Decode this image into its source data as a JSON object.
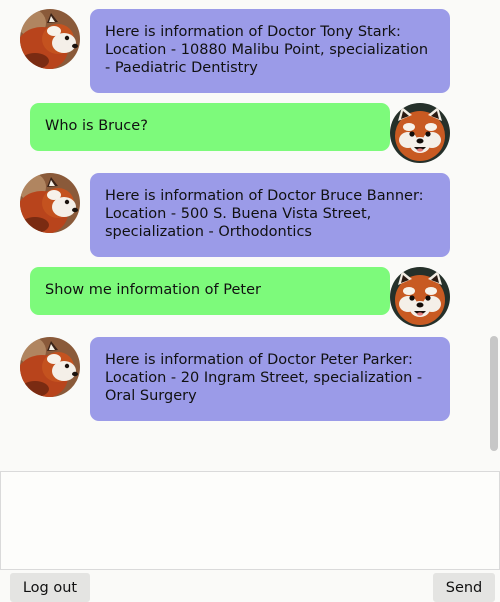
{
  "messages": [
    {
      "role": "bot",
      "text": "Here is information of Doctor Tony Stark: Location - 10880 Malibu Point, specialization - Paediatric Dentistry"
    },
    {
      "role": "user",
      "text": "Who is Bruce?"
    },
    {
      "role": "bot",
      "text": "Here is information of Doctor Bruce Banner: Location - 500 S. Buena Vista Street, specialization - Orthodontics"
    },
    {
      "role": "user",
      "text": "Show me information of Peter"
    },
    {
      "role": "bot",
      "text": "Here is information of Doctor Peter Parker: Location - 20 Ingram Street, specialization - Oral Surgery"
    }
  ],
  "composer": {
    "value": "",
    "placeholder": ""
  },
  "buttons": {
    "logout_label": "Log out",
    "send_label": "Send"
  },
  "colors": {
    "bot_bubble": "#9b9be8",
    "user_bubble": "#7dfa7b",
    "background": "#fafaf8"
  },
  "icons": {
    "bot_avatar": "red-panda-avatar-icon",
    "user_avatar": "red-panda-face-avatar-icon"
  }
}
